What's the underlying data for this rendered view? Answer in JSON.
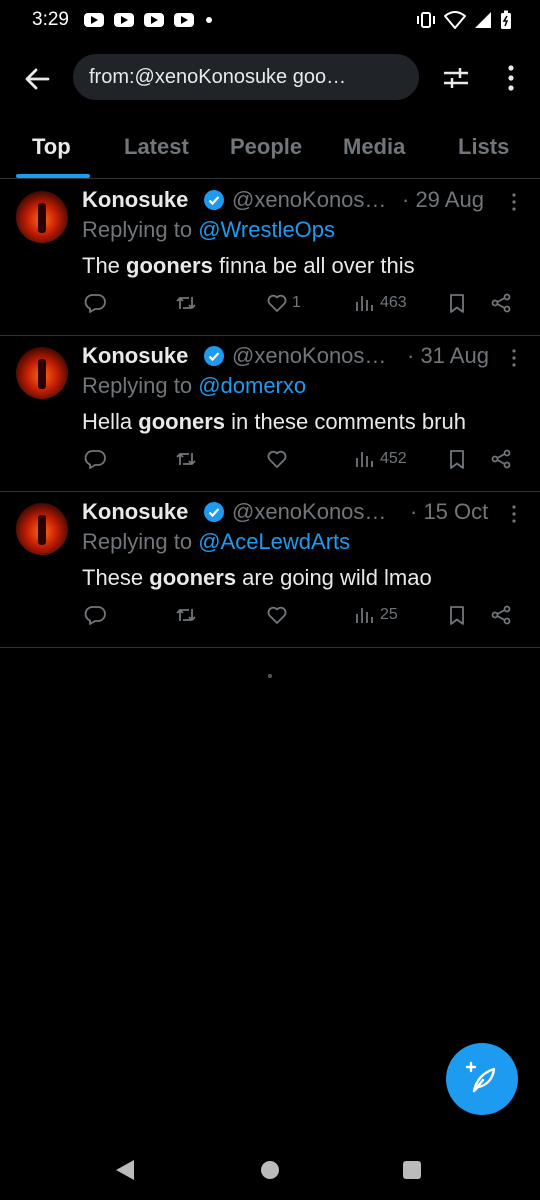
{
  "status_bar": {
    "time": "3:29"
  },
  "search": {
    "query": "from:@xenoKonosuke goo…"
  },
  "tabs": [
    {
      "label": "Top"
    },
    {
      "label": "Latest"
    },
    {
      "label": "People"
    },
    {
      "label": "Media"
    },
    {
      "label": "Lists"
    }
  ],
  "tweets": [
    {
      "name": "Konosuke",
      "handle": "@xenoKonos…",
      "date": "· 29 Aug",
      "replying_prefix": "Replying to ",
      "replying_to": "@WrestleOps",
      "text_before": "The ",
      "text_bold": "gooners",
      "text_after": " finna be all over this",
      "likes": "1",
      "views": "463"
    },
    {
      "name": "Konosuke",
      "handle": "@xenoKonos…",
      "date": "· 31 Aug",
      "replying_prefix": "Replying to ",
      "replying_to": "@domerxo",
      "text_before": "Hella ",
      "text_bold": "gooners",
      "text_after": " in these comments bruh",
      "likes": "",
      "views": "452"
    },
    {
      "name": "Konosuke",
      "handle": "@xenoKonos…",
      "date": "· 15 Oct",
      "replying_prefix": "Replying to ",
      "replying_to": "@AceLewdArts",
      "text_before": "These ",
      "text_bold": "gooners",
      "text_after": " are going wild lmao",
      "likes": "",
      "views": "25"
    }
  ],
  "colors": {
    "accent": "#1d9bf0",
    "muted": "#71767b",
    "text": "#e7e9ea",
    "background": "#000000"
  },
  "icons": [
    "back-arrow-icon",
    "filter-icon",
    "more-vertical-icon",
    "verified-badge-icon",
    "reply-icon",
    "retweet-icon",
    "like-icon",
    "views-icon",
    "bookmark-icon",
    "share-icon",
    "compose-icon"
  ]
}
